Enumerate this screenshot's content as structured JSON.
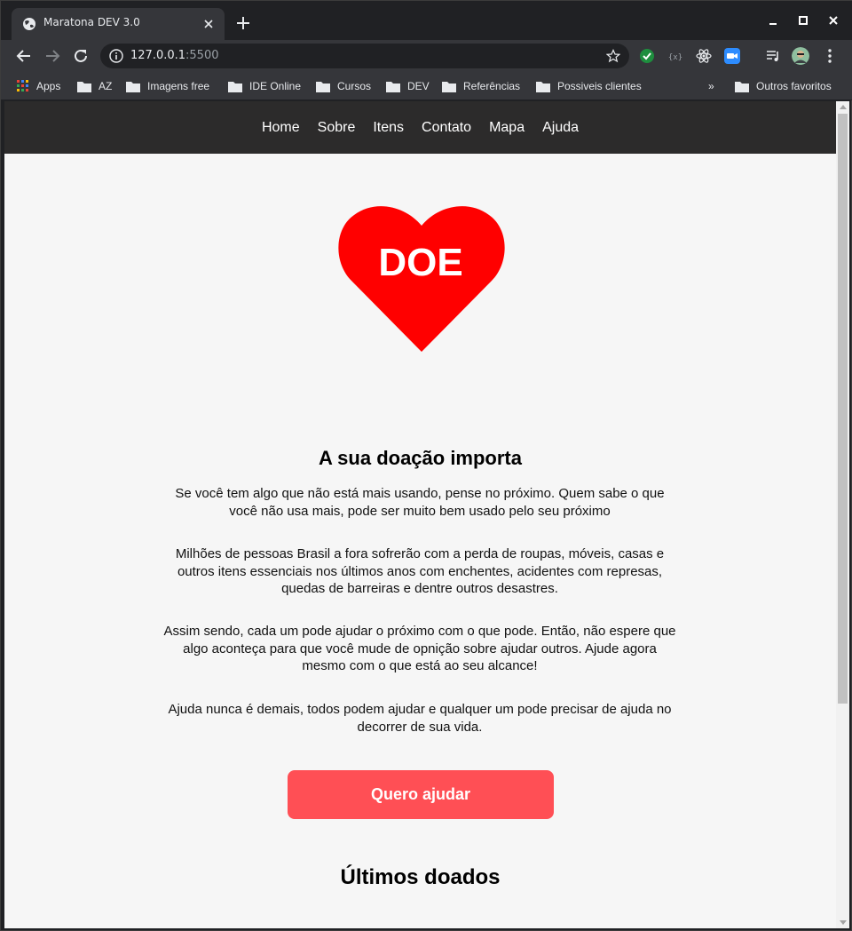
{
  "browser": {
    "tab_title": "Maratona DEV 3.0",
    "url_host": "127.0.0.1",
    "url_port": ":5500",
    "bookmarks": [
      {
        "label": "Apps",
        "icon": "apps-grid-icon"
      },
      {
        "label": "AZ",
        "icon": "folder-icon"
      },
      {
        "label": "Imagens free",
        "icon": "folder-icon"
      },
      {
        "label": "IDE Online",
        "icon": "folder-icon"
      },
      {
        "label": "Cursos",
        "icon": "folder-icon"
      },
      {
        "label": "DEV",
        "icon": "folder-icon"
      },
      {
        "label": "Referências",
        "icon": "folder-icon"
      },
      {
        "label": "Possiveis clientes",
        "icon": "folder-icon"
      }
    ],
    "bookmarks_overflow": "»",
    "other_bookmarks": "Outros favoritos",
    "colors": {
      "frame": "#202124",
      "toolbar": "#35363a",
      "text": "#e8eaed"
    }
  },
  "site": {
    "nav": [
      "Home",
      "Sobre",
      "Itens",
      "Contato",
      "Mapa",
      "Ajuda"
    ],
    "logo_text": "DOE",
    "intro_title": "A sua doação importa",
    "paragraphs": [
      "Se você tem algo que não está mais usando, pense no próximo. Quem sabe o que você não usa mais, pode ser muito bem usado pelo seu próximo",
      "Milhões de pessoas Brasil a fora sofrerão com a perda de roupas, móveis, casas e outros itens essenciais nos últimos anos com enchentes, acidentes com represas, quedas de barreiras e dentre outros desastres.",
      "Assim sendo, cada um pode ajudar o próximo com o que pode. Então, não espere que algo aconteça para que você mude de opnição sobre ajudar outros. Ajude agora mesmo com o que está ao seu alcance!",
      "Ajuda nunca é demais, todos podem ajudar e qualquer um pode precisar de ajuda no decorrer de sua vida."
    ],
    "cta_label": "Quero ajudar",
    "donated_title": "Últimos doados",
    "colors": {
      "header_bg": "#2c2b2b",
      "page_bg": "#f6f6f6",
      "heart": "#ff0000",
      "cta_bg": "#ff4f55"
    }
  }
}
